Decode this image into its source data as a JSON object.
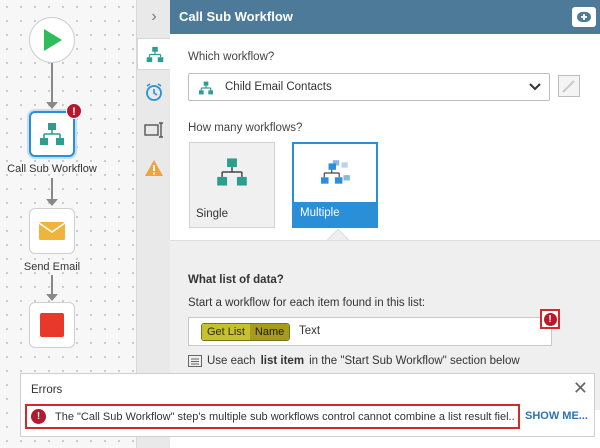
{
  "canvas": {
    "nodes": [
      {
        "label": ""
      },
      {
        "label": "Call Sub Workflow",
        "error_badge": "!"
      },
      {
        "label": "Send Email"
      },
      {
        "label": ""
      }
    ]
  },
  "tabstrip": {
    "collapse_glyph": "›"
  },
  "header": {
    "title": "Call Sub Workflow"
  },
  "panel": {
    "which_label": "Which workflow?",
    "selected_workflow": "Child Email Contacts",
    "how_many_label": "How many workflows?",
    "options": [
      {
        "label": "Single",
        "selected": false
      },
      {
        "label": "Multiple",
        "selected": true
      }
    ],
    "list_section": {
      "title": "What list of data?",
      "description": "Start a workflow for each item found in this list:",
      "token_a": "Get List",
      "token_b": "Name",
      "token_after": "Text",
      "hint_prefix": "Use each",
      "hint_bold": "list item",
      "hint_suffix": "in the \"Start Sub Workflow\" section below"
    }
  },
  "errors": {
    "title": "Errors",
    "message": "The \"Call Sub Workflow\" step's multiple sub workflows control cannot combine a list result fiel...",
    "show_more": "SHOW ME..."
  },
  "colors": {
    "header": "#4d7a98",
    "accent": "#2a8fd6",
    "error": "#b5192d",
    "start": "#2ebd59",
    "stop": "#e8372b",
    "mail": "#f0b43c"
  }
}
